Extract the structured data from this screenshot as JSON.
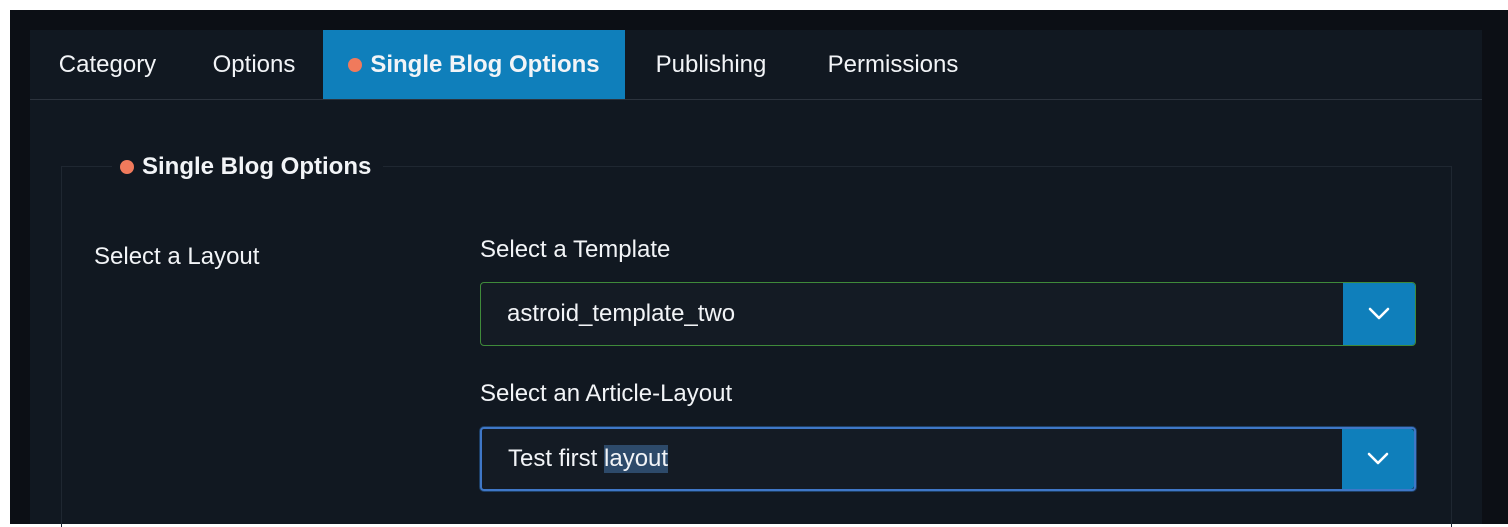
{
  "tabs": [
    {
      "label": "Category",
      "active": false,
      "marked": false
    },
    {
      "label": "Options",
      "active": false,
      "marked": false
    },
    {
      "label": "Single Blog Options",
      "active": true,
      "marked": true
    },
    {
      "label": "Publishing",
      "active": false,
      "marked": false
    },
    {
      "label": "Permissions",
      "active": false,
      "marked": false
    }
  ],
  "section": {
    "title": "Single Blog Options",
    "marker_color": "#f07a5c"
  },
  "layout": {
    "label": "Select a Layout"
  },
  "template": {
    "label": "Select a Template",
    "value": "astroid_template_two"
  },
  "article_layout": {
    "label": "Select an Article-Layout",
    "value_prefix": "Test first ",
    "value_selected": "layout"
  },
  "colors": {
    "accent": "#0f7fbb",
    "background": "#111821",
    "text": "#f2f4f7",
    "valid_border": "#3f8a3a",
    "focus_border": "#3f77c7"
  },
  "icons": {
    "select_caret": "chevron-down-icon",
    "changed_marker": "dot-icon"
  }
}
